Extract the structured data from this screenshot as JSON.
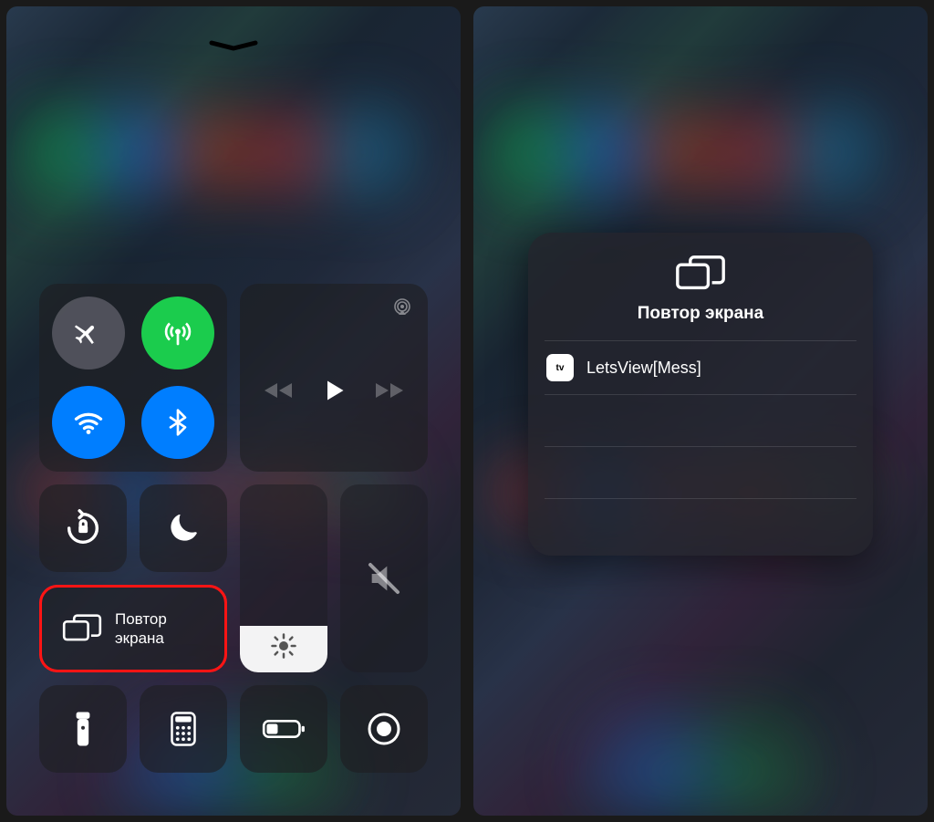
{
  "left": {
    "mirroring_label_line1": "Повтор",
    "mirroring_label_line2": "экрана"
  },
  "right": {
    "picker_title": "Повтор экрана",
    "devices": [
      {
        "name": "LetsView[Mess]",
        "type": "appletv"
      }
    ],
    "appletv_chip": "tv"
  },
  "brightness_percent": 25
}
